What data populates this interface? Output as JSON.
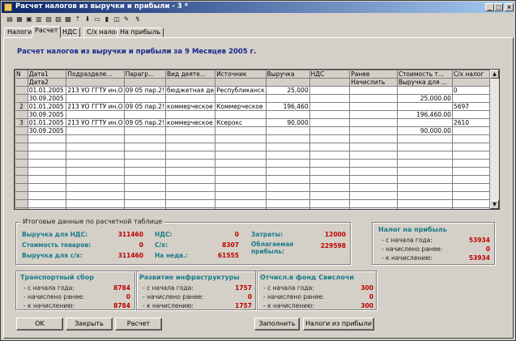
{
  "window": {
    "title": "Расчет налогов из выручки и прибыли - 3 *"
  },
  "tabs": [
    "Налоги",
    "Расчет",
    "НДС",
    "С/х налог",
    "На прибыль"
  ],
  "heading": "Расчет налогов из выручки и прибыли за 9 Месяцев 2005 г.",
  "grid": {
    "columns": [
      "N",
      "Дата1",
      "Подразделе...",
      "Парагр...",
      "Вид деяте...",
      "Источник",
      "Выручка",
      "НДС",
      "Ранее",
      "Стоимость т...",
      "С/х налог"
    ],
    "subcolumns": {
      "date2": "Дата2",
      "earlier_calc": "Начислить",
      "revenue_for": "Выручка для ..."
    },
    "rows": [
      {
        "n": "",
        "date1": "01.01.2005",
        "date2": "30.09.2005",
        "dept": "213 УО ГГТУ ин.О",
        "par": "09 05 пар.2!",
        "kind": "бюджетная де",
        "source": "Республиканск",
        "revenue": "25,000",
        "vat": "",
        "earlier": "",
        "cost": "",
        "cost2": "25,000.00",
        "agri": "0"
      },
      {
        "n": "2",
        "date1": "01.01.2005",
        "date2": "30.09.2005",
        "dept": "213 УО ГГТУ ин.О",
        "par": "09 05 пар.2!",
        "kind": "коммерческое",
        "source": "Коммерческое",
        "revenue": "196,460",
        "vat": "",
        "earlier": "",
        "cost": "",
        "cost2": "196,460.00",
        "agri": "5697"
      },
      {
        "n": "3",
        "date1": "01.01.2005",
        "date2": "30.09.2005",
        "dept": "213 УО ГГТУ ин.О",
        "par": "09 05 пар.2!",
        "kind": "коммерческое",
        "source": "Ксерокс",
        "revenue": "90,000",
        "vat": "",
        "earlier": "",
        "cost": "",
        "cost2": "90,000.00",
        "agri": "2610"
      }
    ]
  },
  "totals": {
    "title": "Итоговые данные по расчетной таблице",
    "vat_revenue_label": "Выручка для НДС:",
    "vat_revenue": "311460",
    "goods_cost_label": "Стоимость товаров:",
    "goods_cost": "0",
    "agri_revenue_label": "Выручка для с/х:",
    "agri_revenue": "311460",
    "vat_label": "НДС:",
    "vat": "0",
    "agri_label": "С/х:",
    "agri": "8307",
    "nedv_label": "На недв.:",
    "nedv": "61555",
    "costs_label": "Затраты:",
    "costs": "12000",
    "taxable_label": "Облагаемая прибыль:",
    "taxable": "229598"
  },
  "profit_tax": {
    "title": "Налог на прибыль",
    "ytd_label": "- с начала года:",
    "ytd": "53934",
    "earlier_label": "- начислено ранее:",
    "earlier": "0",
    "due_label": "- к начислению:",
    "due": "53934"
  },
  "transport": {
    "title": "Транспортный сбор",
    "ytd_label": "- с начала года:",
    "ytd": "8784",
    "earlier_label": "- начислено ранее:",
    "earlier": "0",
    "due_label": "- к начислению:",
    "due": "8784"
  },
  "infra": {
    "title": "Развитие инфраструктуры",
    "ytd_label": "- с начала года:",
    "ytd": "1757",
    "earlier_label": "- начислено ранее:",
    "earlier": "0",
    "due_label": "- к начислению:",
    "due": "1757"
  },
  "fund": {
    "title": "Отчисл.в фонд Свислочи",
    "ytd_label": "- с начала года:",
    "ytd": "300",
    "earlier_label": "- начислено ранее:",
    "earlier": "0",
    "due_label": "- к начислению:",
    "due": "300"
  },
  "buttons": {
    "ok": "OK",
    "close": "Закрыть",
    "calc": "Расчет",
    "fill": "Заполнить",
    "profit_taxes": "Налоги из прибыли"
  },
  "colors": {
    "title_start": "#0a246a",
    "label": "#1a7a8a",
    "value": "#c00000",
    "heading": "#1a2a8a"
  },
  "icons": [
    "new-icon",
    "open-icon",
    "print-icon",
    "preview-icon",
    "copy-icon",
    "paste-icon",
    "up-icon",
    "down-icon",
    "filter-icon",
    "sort-icon",
    "find-icon"
  ]
}
